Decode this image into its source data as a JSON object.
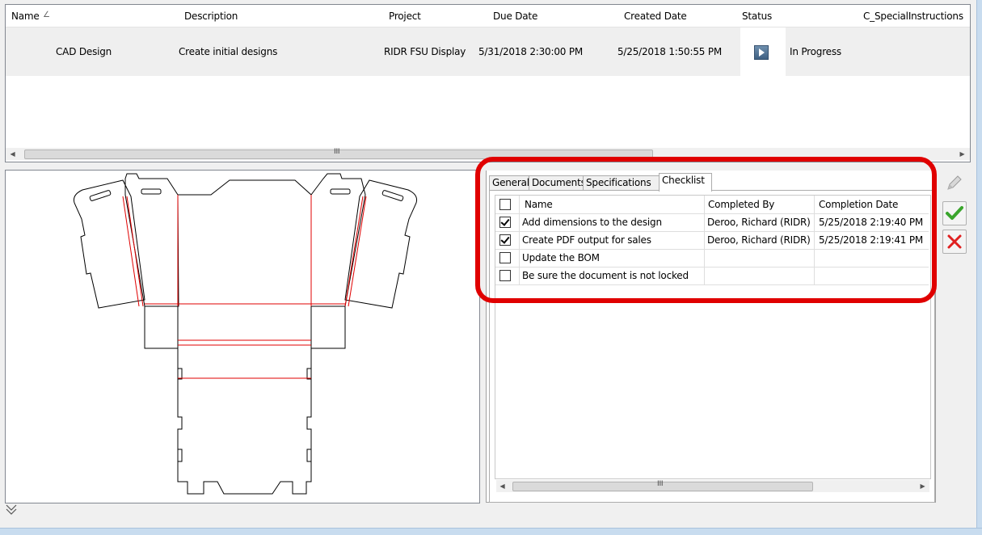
{
  "grid": {
    "columns": [
      "Name",
      "Description",
      "Project",
      "Due Date",
      "Created Date",
      "Status",
      "C_SpecialInstructions"
    ],
    "sort_indicator": "∠",
    "rows": [
      {
        "name": "CAD Design",
        "description": "Create initial designs",
        "project": "RIDR FSU Display",
        "due_date": "5/31/2018 2:30:00 PM",
        "created_date": "5/25/2018 1:50:55 PM",
        "status": "In Progress",
        "status_icon": "play-icon"
      }
    ],
    "scroll_grip": "III"
  },
  "tabs": [
    {
      "label": "General",
      "active": false
    },
    {
      "label": "Documents",
      "active": false
    },
    {
      "label": "Specifications",
      "active": false
    },
    {
      "label": "Checklist",
      "active": true
    }
  ],
  "checklist": {
    "columns": [
      "Name",
      "Completed By",
      "Completion Date"
    ],
    "items": [
      {
        "checked": true,
        "name": "Add dimensions to the design",
        "completed_by": "Deroo, Richard (RIDR)",
        "completion_date": "5/25/2018 2:19:40 PM"
      },
      {
        "checked": true,
        "name": "Create PDF output for sales",
        "completed_by": "Deroo, Richard (RIDR)",
        "completion_date": "5/25/2018 2:19:41 PM"
      },
      {
        "checked": false,
        "name": "Update the BOM",
        "completed_by": "",
        "completion_date": ""
      },
      {
        "checked": false,
        "name": "Be sure the document is not locked",
        "completed_by": "",
        "completion_date": ""
      }
    ],
    "scroll_grip": "III"
  },
  "side_buttons": [
    "pencil-icon",
    "checkmark-icon",
    "close-icon"
  ],
  "colors": {
    "highlight": "#e00000",
    "dieline_cut": "#000000",
    "dieline_crease": "#e00000",
    "accept": "#3aa52c",
    "reject": "#e02020"
  }
}
